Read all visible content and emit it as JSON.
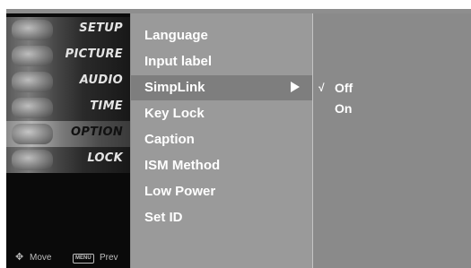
{
  "sidebar": {
    "items": [
      {
        "label": "SETUP",
        "active": false
      },
      {
        "label": "PICTURE",
        "active": false
      },
      {
        "label": "AUDIO",
        "active": false
      },
      {
        "label": "TIME",
        "active": false
      },
      {
        "label": "OPTION",
        "active": true
      },
      {
        "label": "LOCK",
        "active": false
      }
    ],
    "footer": {
      "move_icon": "joystick-icon",
      "move_label": "Move",
      "menu_key_label": "MENU",
      "prev_label": "Prev"
    }
  },
  "menu": {
    "items": [
      {
        "label": "Language"
      },
      {
        "label": "Input label"
      },
      {
        "label": "SimpLink",
        "selected": true,
        "has_submenu": true
      },
      {
        "label": "Key Lock"
      },
      {
        "label": "Caption"
      },
      {
        "label": "ISM Method"
      },
      {
        "label": "Low Power"
      },
      {
        "label": "Set ID"
      }
    ]
  },
  "options": {
    "items": [
      {
        "label": "Off",
        "checked": true,
        "check_mark": "√"
      },
      {
        "label": "On",
        "checked": false
      }
    ]
  },
  "colors": {
    "sidebar_bg": "#0a0a0a",
    "menu_bg": "#9a9a9a",
    "menu_selected_bg": "#7e7e7e",
    "options_bg": "#8a8a8a",
    "text": "#ffffff"
  }
}
